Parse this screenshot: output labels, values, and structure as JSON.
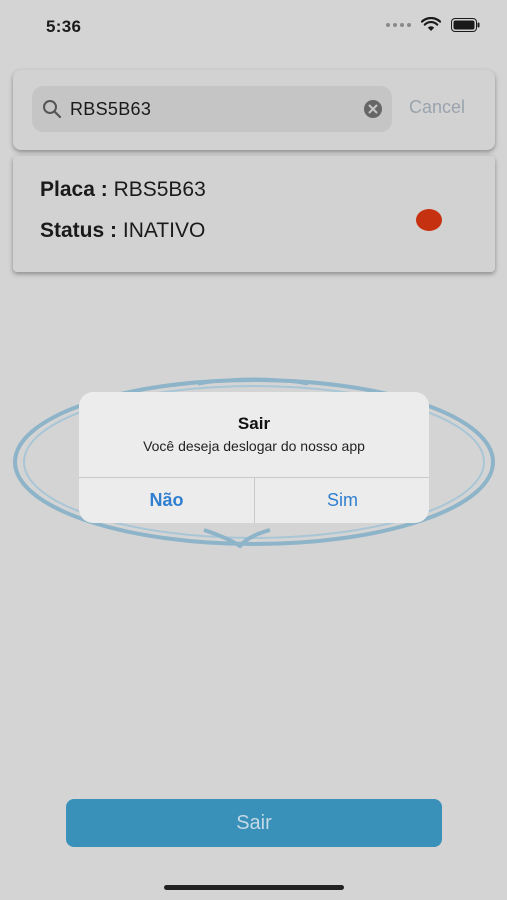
{
  "status_bar": {
    "time": "5:36",
    "icons": [
      "signal-dots-icon",
      "wifi-icon",
      "battery-icon"
    ]
  },
  "search": {
    "value": "RBS5B63",
    "cancel_label": "Cancel"
  },
  "vehicle": {
    "plate_label": "Placa :",
    "plate_value": "RBS5B63",
    "status_label": "Status :",
    "status_value": "INATIVO",
    "status_color": "#c63110"
  },
  "alert": {
    "title": "Sair",
    "message": "Você deseja deslogar do nosso app",
    "cancel_label": "Não",
    "confirm_label": "Sim",
    "button_color": "#2f7fd0"
  },
  "footer": {
    "logout_label": "Sair",
    "button_color": "#3990b8"
  }
}
